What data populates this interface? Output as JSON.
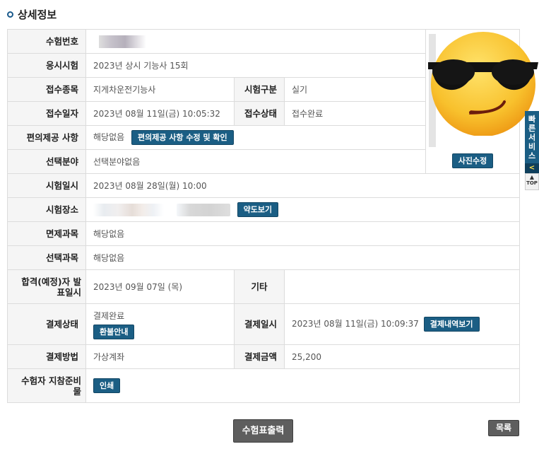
{
  "section": {
    "title": "상세정보"
  },
  "rows": {
    "exam_number": {
      "label": "수험번호"
    },
    "exam": {
      "label": "응시시험",
      "value": "2023년 상시 기능사 15회"
    },
    "category": {
      "label": "접수종목",
      "value": "지게차운전기능사"
    },
    "exam_type": {
      "label": "시험구분",
      "value": "실기"
    },
    "reg_date": {
      "label": "접수일자",
      "value": "2023년 08월 11일(금) 10:05:32"
    },
    "reg_status": {
      "label": "접수상태",
      "value": "접수완료"
    },
    "convenience": {
      "label": "편의제공 사항",
      "value": "해당없음",
      "button": "편의제공 사항 수정 및 확인"
    },
    "selected_field": {
      "label": "선택분야",
      "value": "선택분야없음"
    },
    "exam_date": {
      "label": "시험일시",
      "value": "2023년 08월 28일(월) 10:00"
    },
    "exam_place": {
      "label": "시험장소",
      "button": "약도보기"
    },
    "exempt": {
      "label": "면제과목",
      "value": "해당없음"
    },
    "selected_subject": {
      "label": "선택과목",
      "value": "해당없음"
    },
    "pass_date": {
      "label": "합격(예정)자 발표일시",
      "value": "2023년 09월 07일 (목)"
    },
    "etc": {
      "label": "기타"
    },
    "pay_status": {
      "label": "결제상태",
      "value": "결제완료",
      "button": "환불안내"
    },
    "pay_date": {
      "label": "결제일시",
      "value": "2023년 08월 11일(금) 10:09:37",
      "button": "결제내역보기"
    },
    "pay_method": {
      "label": "결제방법",
      "value": "가상계좌"
    },
    "pay_amount": {
      "label": "결제금액",
      "value": "25,200"
    },
    "guide": {
      "label": "수험자 지참준비물",
      "button": "인쇄"
    }
  },
  "photo": {
    "button": "사진수정",
    "emoji": "😎"
  },
  "footer": {
    "print_button": "수험표출력",
    "list_button": "목록"
  },
  "quick_service": {
    "label": [
      "빠",
      "른",
      "서",
      "비",
      "스"
    ],
    "arrow": "<",
    "top": "TOP"
  }
}
